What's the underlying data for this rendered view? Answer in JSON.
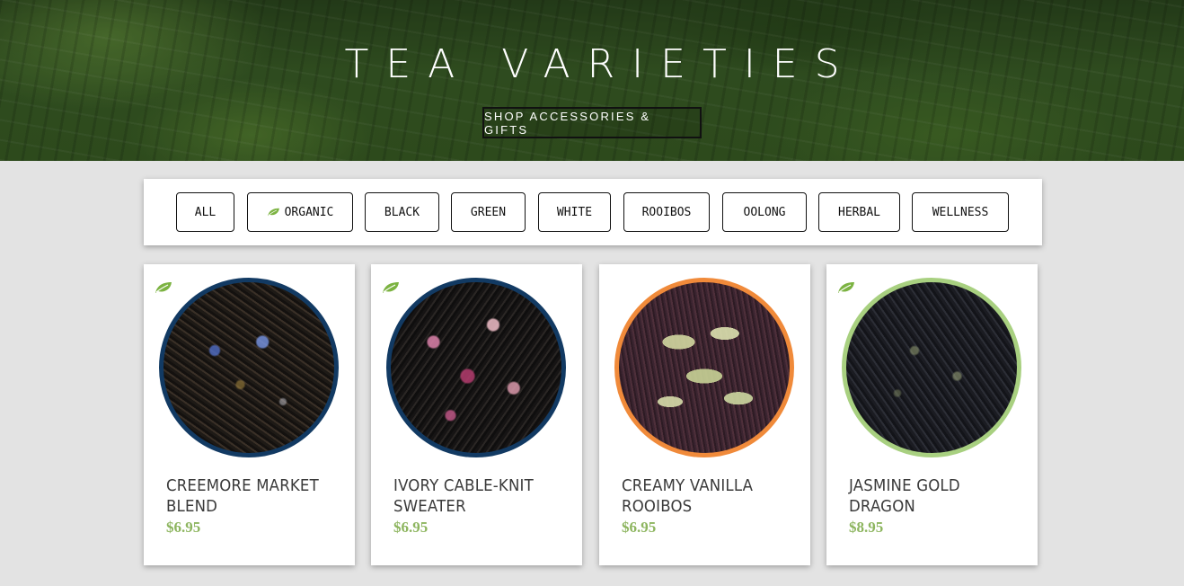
{
  "hero": {
    "title": "TEA VARIETIES",
    "button_label": "SHOP ACCESSORIES & GIFTS"
  },
  "filters": [
    {
      "label": "ALL",
      "icon": null
    },
    {
      "label": "ORGANIC",
      "icon": "leaf-icon"
    },
    {
      "label": "BLACK",
      "icon": null
    },
    {
      "label": "GREEN",
      "icon": null
    },
    {
      "label": "WHITE",
      "icon": null
    },
    {
      "label": "ROOIBOS",
      "icon": null
    },
    {
      "label": "OOLONG",
      "icon": null
    },
    {
      "label": "HERBAL",
      "icon": null
    },
    {
      "label": "WELLNESS",
      "icon": null
    }
  ],
  "products": [
    {
      "name": "CREEMORE MARKET BLEND",
      "price": "$6.95",
      "organic": true,
      "ring_color": "#123a63"
    },
    {
      "name": "IVORY CABLE-KNIT SWEATER",
      "price": "$6.95",
      "organic": true,
      "ring_color": "#123a63"
    },
    {
      "name": "CREAMY VANILLA ROOIBOS",
      "price": "$6.95",
      "organic": false,
      "ring_color": "#f08a3a"
    },
    {
      "name": "JASMINE GOLD DRAGON",
      "price": "$8.95",
      "organic": true,
      "ring_color": "#a8d080"
    }
  ],
  "colors": {
    "accent_green": "#8db55f",
    "leaf_icon": "#7cb342",
    "page_background": "#e3e3e3"
  }
}
